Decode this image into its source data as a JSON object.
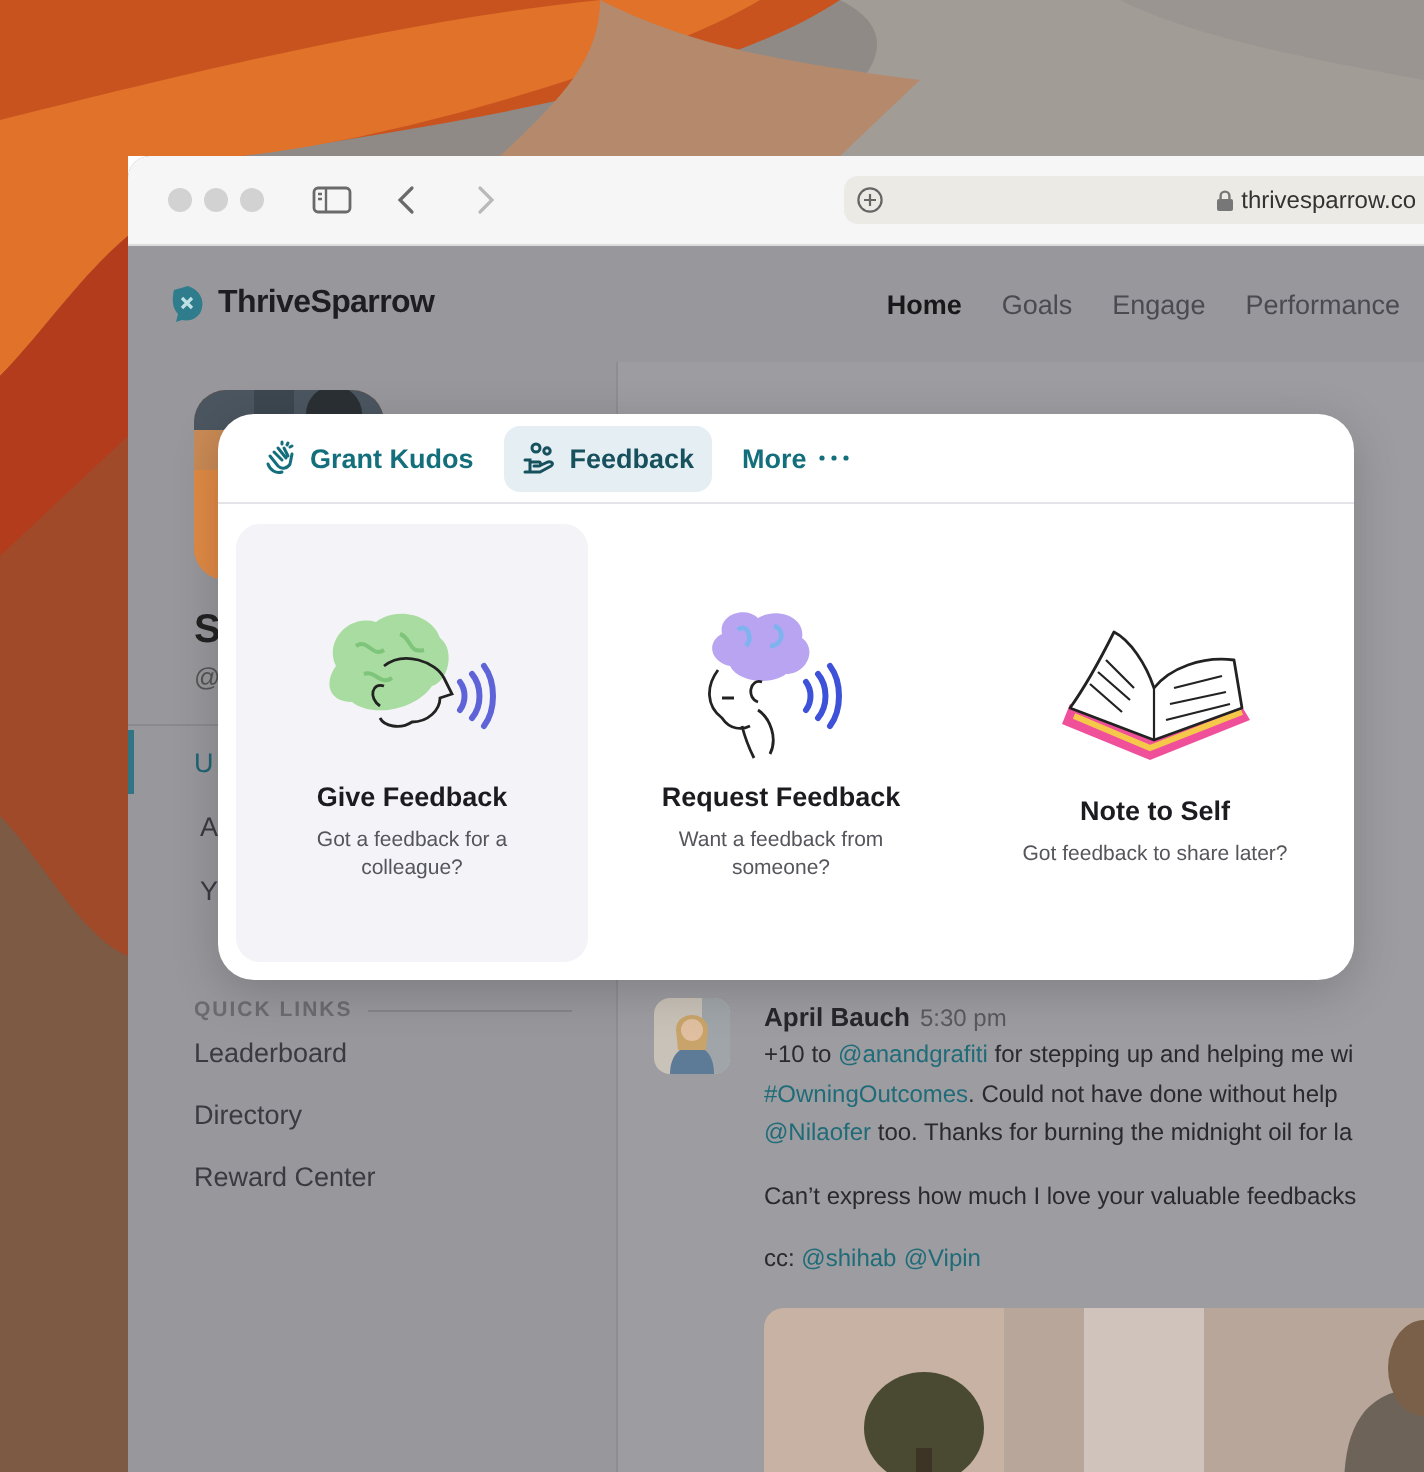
{
  "browser": {
    "nav_buttons": [
      {
        "kind": "back",
        "disabled": false
      },
      {
        "kind": "forward",
        "disabled": true
      }
    ],
    "url": "thrivesparrow.co"
  },
  "header": {
    "logo": "ThriveSparrow",
    "nav": [
      {
        "label": "Home",
        "selected": true
      },
      {
        "label": "Goals",
        "selected": false
      },
      {
        "label": "Engage",
        "selected": false
      },
      {
        "label": "Performance",
        "selected": false
      }
    ]
  },
  "profile": {
    "name": "S",
    "handle": "@"
  },
  "sidebar": {
    "items": [
      {
        "label": "U",
        "selected": true
      },
      {
        "label": "A",
        "selected": false
      },
      {
        "label": "Y",
        "selected": false
      }
    ],
    "quick_links_title": "QUICK LINKS",
    "quick_links": [
      "Leaderboard",
      "Directory",
      "Reward Center"
    ]
  },
  "post": {
    "author": "April Bauch",
    "time": "5:30 pm",
    "paragraphs": [
      [
        [
          {
            "text": "+10 to "
          },
          {
            "text": "@anandgrafiti",
            "link": true
          },
          {
            "text": " for stepping up and helping me wi"
          }
        ],
        [
          {
            "text": "#OwningOutcomes",
            "link": true
          },
          {
            "text": ". Could not have done without help"
          }
        ],
        [
          {
            "text": "@Nilaofer",
            "link": true
          },
          {
            "text": " too. Thanks for burning the midnight oil for la"
          }
        ]
      ],
      [
        [
          {
            "text": "Can’t express how much I love your valuable feedbacks"
          }
        ]
      ],
      [
        [
          {
            "text": "cc: "
          },
          {
            "text": "@shihab",
            "link": true
          },
          {
            "text": "@Vipin",
            "link": true
          }
        ]
      ]
    ]
  },
  "popup": {
    "tabs": [
      {
        "kind": "kudos",
        "label": "Grant Kudos",
        "selected": false
      },
      {
        "kind": "feedback",
        "label": "Feedback",
        "selected": true
      },
      {
        "kind": "more",
        "label": "More",
        "selected": false
      }
    ],
    "cards": [
      {
        "kind": "give",
        "title": "Give Feedback",
        "description": "Got a feedback for a colleague?",
        "selected": true
      },
      {
        "kind": "request",
        "title": "Request Feedback",
        "description": "Want a feedback from someone?",
        "selected": false
      },
      {
        "kind": "note",
        "title": "Note to Self",
        "description": "Got feedback to share later?",
        "selected": false
      }
    ]
  }
}
